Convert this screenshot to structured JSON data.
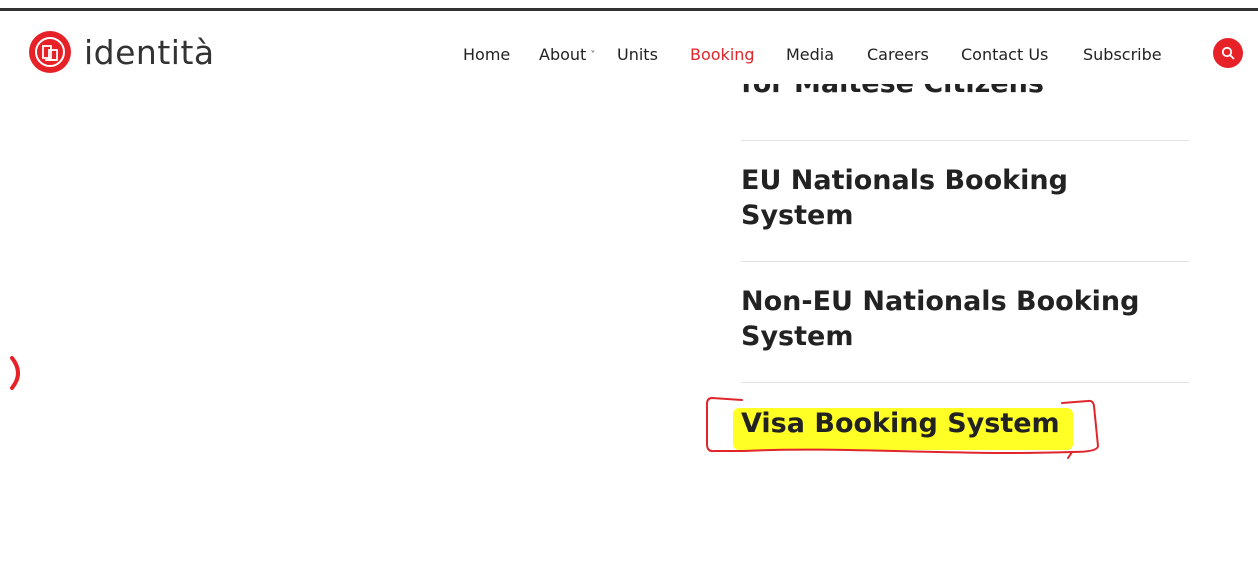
{
  "brand": {
    "name": "identità",
    "accent": "#e62128"
  },
  "nav": {
    "items": [
      {
        "label": "Home"
      },
      {
        "label": "About",
        "has_dropdown": true
      },
      {
        "label": "Units"
      },
      {
        "label": "Booking",
        "active": true
      },
      {
        "label": "Media"
      },
      {
        "label": "Careers"
      },
      {
        "label": "Contact Us"
      },
      {
        "label": "Subscribe"
      }
    ],
    "search_icon": "search-icon"
  },
  "content": {
    "partial_item": "for Maltese Citizens",
    "items": [
      {
        "title_line1": "EU Nationals Booking",
        "title_line2": "System"
      },
      {
        "title_line1": "Non-EU Nationals Booking",
        "title_line2": "System"
      },
      {
        "title": "Visa Booking System",
        "highlight": "#ffff1a",
        "annotation_color": "#e0262b"
      }
    ]
  }
}
